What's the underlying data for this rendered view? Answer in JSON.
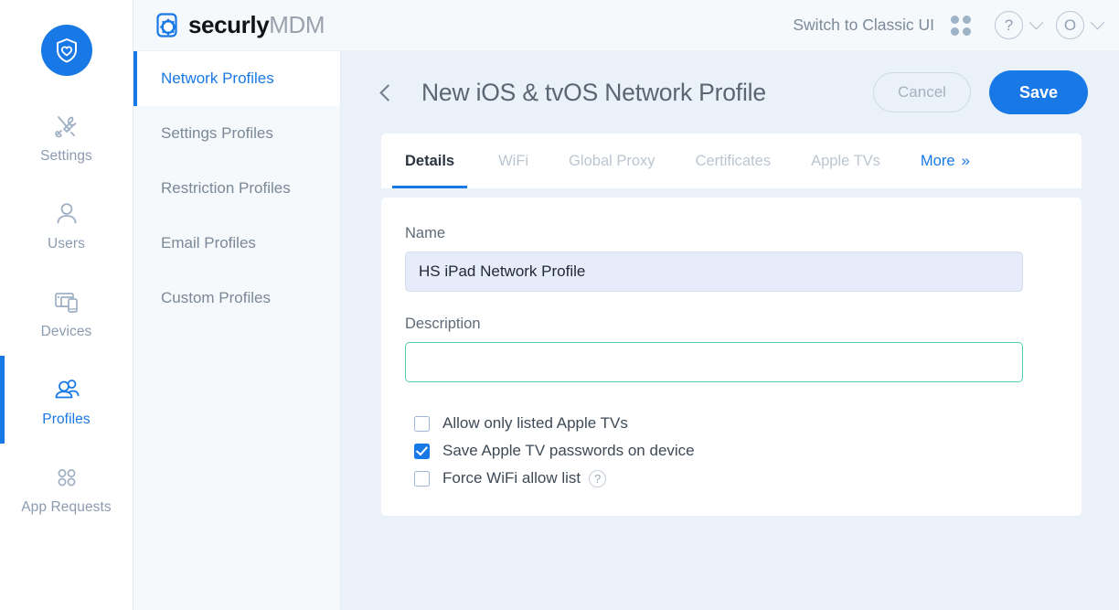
{
  "rail": {
    "logo_icon": "shield-heart-icon",
    "items": [
      {
        "label": "Settings",
        "icon": "tools-icon",
        "active": false
      },
      {
        "label": "Users",
        "icon": "user-icon",
        "active": false
      },
      {
        "label": "Devices",
        "icon": "devices-icon",
        "active": false
      },
      {
        "label": "Profiles",
        "icon": "profiles-icon",
        "active": true
      },
      {
        "label": "App Requests",
        "icon": "app-grid-icon",
        "active": false
      }
    ]
  },
  "header": {
    "brand_primary": "securly",
    "brand_secondary": "MDM",
    "brand_icon": "securly-gear-icon",
    "classic_ui_label": "Switch to Classic UI",
    "grid_icon": "apps-grid-icon",
    "help_icon_label": "?",
    "avatar_label": "O"
  },
  "subnav": {
    "items": [
      {
        "label": "Network Profiles",
        "active": true
      },
      {
        "label": "Settings Profiles",
        "active": false
      },
      {
        "label": "Restriction Profiles",
        "active": false
      },
      {
        "label": "Email Profiles",
        "active": false
      },
      {
        "label": "Custom Profiles",
        "active": false
      }
    ]
  },
  "page": {
    "back_icon": "chevron-left-icon",
    "title": "New iOS & tvOS Network Profile",
    "cancel_label": "Cancel",
    "save_label": "Save"
  },
  "tabs": [
    {
      "label": "Details",
      "state": "active"
    },
    {
      "label": "WiFi",
      "state": "muted"
    },
    {
      "label": "Global Proxy",
      "state": "muted"
    },
    {
      "label": "Certificates",
      "state": "muted"
    },
    {
      "label": "Apple TVs",
      "state": "muted"
    },
    {
      "label": "More",
      "state": "more",
      "arrows": "»"
    }
  ],
  "form": {
    "name_label": "Name",
    "name_value": "HS iPad Network Profile",
    "name_placeholder": "",
    "description_label": "Description",
    "description_value": "",
    "description_placeholder": "",
    "checkboxes": [
      {
        "label": "Allow only listed Apple TVs",
        "checked": false,
        "help": false
      },
      {
        "label": "Save Apple TV passwords on device",
        "checked": true,
        "help": false
      },
      {
        "label": "Force WiFi allow list",
        "checked": false,
        "help": true,
        "help_icon": "question-circle-icon",
        "help_glyph": "?"
      }
    ]
  },
  "colors": {
    "accent": "#1879e6",
    "main_bg": "#eaf1f9",
    "header_bg": "#f6f9fc",
    "focus_border": "#4ecfb0",
    "name_field_bg": "#e6ecfa"
  }
}
